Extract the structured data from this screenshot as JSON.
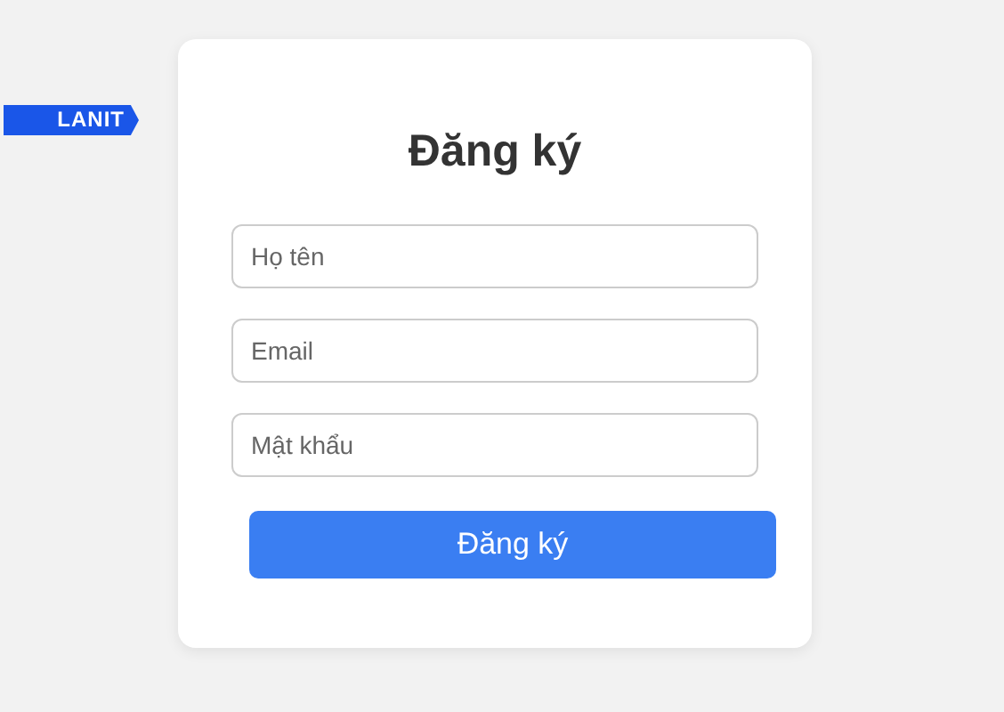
{
  "logo": {
    "text": "LANIT"
  },
  "form": {
    "title": "Đăng ký",
    "fields": [
      {
        "placeholder": "Họ tên"
      },
      {
        "placeholder": "Email"
      },
      {
        "placeholder": "Mật khẩu"
      }
    ],
    "submit": "Đăng ký"
  }
}
